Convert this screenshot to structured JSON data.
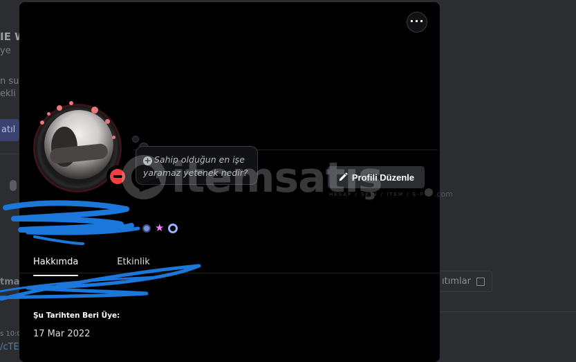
{
  "background": {
    "title_fragment": "IE W",
    "sub_fragment": "ye",
    "line3": "n sur",
    "line4": "ekli",
    "button_fragment": "atıl",
    "line5": "tmak",
    "line6": "s 10:0",
    "line7": "/cTE",
    "right_button": "ıtımlar"
  },
  "profile": {
    "more_label": "···",
    "note_prompt": "Sahip olduğun en işe yaramaz yetenek nedir?",
    "edit_button": "Profili Düzenle",
    "tabs": [
      {
        "label": "Hakkımda",
        "active": true
      },
      {
        "label": "Etkinlik",
        "active": false
      }
    ],
    "member_since_label": "Şu Tarihten Beri Üye:",
    "member_since_value": "17 Mar 2022",
    "status": "do-not-disturb",
    "badges": [
      "blue-circle-badge",
      "pink-star-badge",
      "blue-gear-badge"
    ]
  },
  "watermark": {
    "text": "itemsatış",
    "sub": "HESAP / SKIN / ITEM / E-PIN",
    "suffix": ".com"
  },
  "colors": {
    "dnd": "#f23f43",
    "modal_bg": "#000000",
    "redaction": "#1b77d9"
  }
}
